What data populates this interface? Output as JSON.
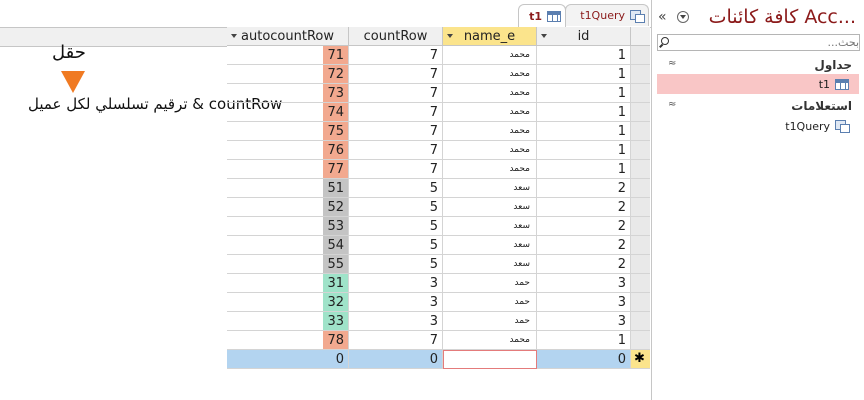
{
  "tabs": [
    {
      "label": "t1",
      "icon": "table-icon",
      "active": true
    },
    {
      "label": "t1Query",
      "icon": "query-icon",
      "active": false
    }
  ],
  "columns": [
    "autocountRow",
    "countRow",
    "name_e",
    "id"
  ],
  "rows": [
    {
      "autocountRow": "71",
      "countRow": "7",
      "name_e": "محمد",
      "id": "1",
      "color": "#f2a98f"
    },
    {
      "autocountRow": "72",
      "countRow": "7",
      "name_e": "محمد",
      "id": "1",
      "color": "#f2a98f"
    },
    {
      "autocountRow": "73",
      "countRow": "7",
      "name_e": "محمد",
      "id": "1",
      "color": "#f2a98f"
    },
    {
      "autocountRow": "74",
      "countRow": "7",
      "name_e": "محمد",
      "id": "1",
      "color": "#f2a98f"
    },
    {
      "autocountRow": "75",
      "countRow": "7",
      "name_e": "محمد",
      "id": "1",
      "color": "#f2a98f"
    },
    {
      "autocountRow": "76",
      "countRow": "7",
      "name_e": "محمد",
      "id": "1",
      "color": "#f2a98f"
    },
    {
      "autocountRow": "77",
      "countRow": "7",
      "name_e": "محمد",
      "id": "1",
      "color": "#f2a98f"
    },
    {
      "autocountRow": "51",
      "countRow": "5",
      "name_e": "سعد",
      "id": "2",
      "color": "#c4c4c4"
    },
    {
      "autocountRow": "52",
      "countRow": "5",
      "name_e": "سعد",
      "id": "2",
      "color": "#c4c4c4"
    },
    {
      "autocountRow": "53",
      "countRow": "5",
      "name_e": "سعد",
      "id": "2",
      "color": "#c4c4c4"
    },
    {
      "autocountRow": "54",
      "countRow": "5",
      "name_e": "سعد",
      "id": "2",
      "color": "#c4c4c4"
    },
    {
      "autocountRow": "55",
      "countRow": "5",
      "name_e": "سعد",
      "id": "2",
      "color": "#c4c4c4"
    },
    {
      "autocountRow": "31",
      "countRow": "3",
      "name_e": "حمد",
      "id": "3",
      "color": "#9fe3c9"
    },
    {
      "autocountRow": "32",
      "countRow": "3",
      "name_e": "حمد",
      "id": "3",
      "color": "#9fe3c9"
    },
    {
      "autocountRow": "33",
      "countRow": "3",
      "name_e": "حمد",
      "id": "3",
      "color": "#9fe3c9"
    },
    {
      "autocountRow": "78",
      "countRow": "7",
      "name_e": "محمد",
      "id": "1",
      "color": "#f2a98f"
    }
  ],
  "new_row": {
    "autocountRow": "0",
    "countRow": "0",
    "name_e": "",
    "id": "0",
    "marker": "✱"
  },
  "annotation": {
    "title": "حقل",
    "text": "ترقيم تسلسلي لكل عميل & countRow",
    "arrow_color": "#f07a22"
  },
  "nav": {
    "collapse_glyph": "«",
    "title": "كافة كائنات Acc...",
    "search_placeholder": "بحث...",
    "groups": [
      {
        "label": "جداول",
        "chevron": "≈",
        "items": [
          {
            "label": "t1",
            "icon": "table-icon",
            "selected": true
          }
        ]
      },
      {
        "label": "استعلامات",
        "chevron": "≈",
        "items": [
          {
            "label": "t1Query",
            "icon": "query-icon",
            "selected": false
          }
        ]
      }
    ]
  },
  "colors": {
    "accent": "#8b1a1a",
    "selected_header": "#fbe48c",
    "new_row": "#b3d4f0",
    "nav_selected": "#f9c6c6"
  }
}
